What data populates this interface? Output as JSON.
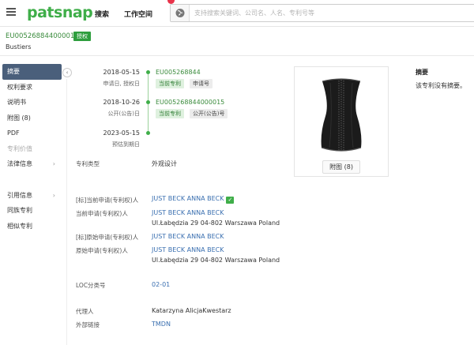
{
  "header": {
    "logo": "patsnap",
    "nav": [
      "搜索",
      "工作空间"
    ],
    "search_placeholder": "支持搜索关键词、公司名、人名、专利号等"
  },
  "patent": {
    "number": "EU005268844000015",
    "status": "授权",
    "title": "Bustiers"
  },
  "sidebar": {
    "items": [
      {
        "label": "摘要",
        "active": true
      },
      {
        "label": "权利要求"
      },
      {
        "label": "说明书"
      },
      {
        "label": "附图 (8)"
      },
      {
        "label": "PDF"
      },
      {
        "label": "专利价值",
        "disabled": true
      },
      {
        "label": "法律信息",
        "chevron": "›"
      }
    ],
    "items2": [
      {
        "label": "引用信息",
        "chevron": "›"
      },
      {
        "label": "同族专利"
      },
      {
        "label": "相似专利"
      }
    ]
  },
  "timeline": [
    {
      "date": "2018-05-15",
      "sub": "申请日, 授权日",
      "link": "EU005268844",
      "tags": [
        "当前专利",
        "申请号"
      ]
    },
    {
      "date": "2018-10-26",
      "sub": "公开(公告)日",
      "link": "EU005268844000015",
      "tags": [
        "当前专利",
        "公开(公告)号"
      ]
    },
    {
      "date": "2023-05-15",
      "sub": "预估到期日"
    }
  ],
  "fields": {
    "patent_type_label": "专利类型",
    "patent_type_value": "外观设计",
    "std_current_assignee_label": "[标]当前申请(专利权)人",
    "std_current_assignee_value": "JUST BECK ANNA BECK",
    "current_assignee_label": "当前申请(专利权)人",
    "current_assignee_value": "JUST BECK ANNA BECK",
    "current_assignee_address": "Ul.Łabędzia 29 04-802 Warszawa Poland",
    "std_original_assignee_label": "[标]原始申请(专利权)人",
    "std_original_assignee_value": "JUST BECK ANNA BECK",
    "original_assignee_label": "原始申请(专利权)人",
    "original_assignee_value": "JUST BECK ANNA BECK",
    "original_assignee_address": "Ul.Łabędzia 29 04-802 Warszawa Poland",
    "loc_label": "LOC分类号",
    "loc_value": "02-01",
    "agent_label": "代理人",
    "agent_value": "Katarzyna AlicjaKwestarz",
    "external_link_label": "外部链接",
    "external_link_value": "TMDN"
  },
  "drawing": {
    "button": "附图 (8)"
  },
  "abstract": {
    "title": "摘要",
    "text": "该专利没有摘要。"
  }
}
